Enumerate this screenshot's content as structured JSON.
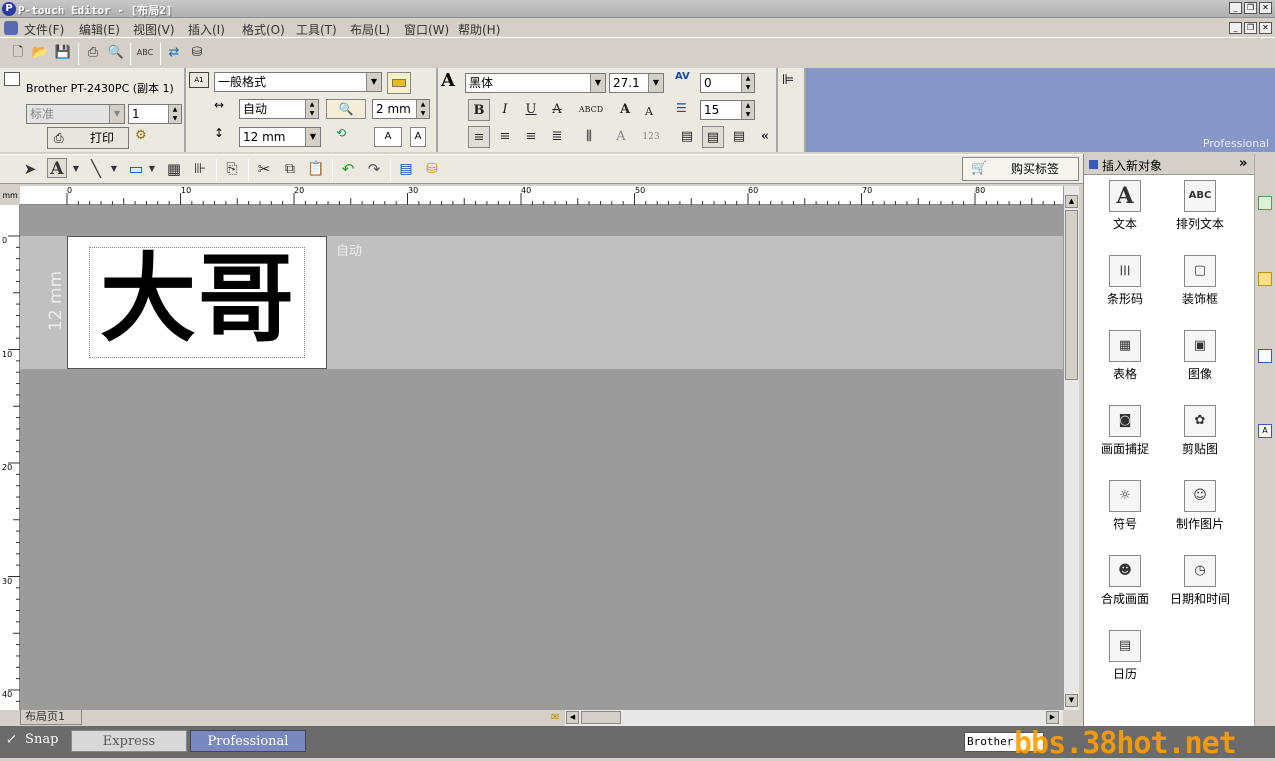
{
  "window": {
    "title": "P-touch Editor - [布局2]"
  },
  "menu": [
    "文件(F)",
    "编辑(E)",
    "视图(V)",
    "插入(I)",
    "格式(O)",
    "工具(T)",
    "布局(L)",
    "窗口(W)",
    "帮助(H)"
  ],
  "printer": {
    "name": "Brother PT-2430PC (副本 1)",
    "quality": "标准",
    "copies": "1",
    "print_label": "打印"
  },
  "label_format": {
    "style": "一般格式",
    "length": "自动",
    "margin": "2 mm",
    "tape_width": "12 mm"
  },
  "font": {
    "family": "黑体",
    "size": "27.1",
    "char_spacing": "0",
    "line_spacing": "15"
  },
  "ribbon_brand": "Professional",
  "toolbar": {
    "buy_labels": "购买标签"
  },
  "canvas": {
    "label_text": "大哥",
    "length_hint": "自动",
    "tape_width_text": "12 mm",
    "sheet_tab": "布局页1"
  },
  "ruler": {
    "unit": "mm",
    "h_ticks": [
      "0",
      "10",
      "20",
      "30",
      "40",
      "50",
      "60",
      "70",
      "80"
    ],
    "v_ticks": [
      "0",
      "10",
      "20",
      "30",
      "40"
    ]
  },
  "sidebar": {
    "title": "插入新对象",
    "items": [
      {
        "label": "文本",
        "icon": "text-icon",
        "glyph": "A"
      },
      {
        "label": "排列文本",
        "icon": "arranged-text-icon",
        "glyph": "ABC"
      },
      {
        "label": "条形码",
        "icon": "barcode-icon",
        "glyph": "|||"
      },
      {
        "label": "装饰框",
        "icon": "frame-icon",
        "glyph": "▢"
      },
      {
        "label": "表格",
        "icon": "table-icon",
        "glyph": "▦"
      },
      {
        "label": "图像",
        "icon": "image-icon",
        "glyph": "▣"
      },
      {
        "label": "画面捕捉",
        "icon": "screen-capture-icon",
        "glyph": "◙"
      },
      {
        "label": "剪贴图",
        "icon": "clip-art-icon",
        "glyph": "✿"
      },
      {
        "label": "符号",
        "icon": "symbol-icon",
        "glyph": "☼"
      },
      {
        "label": "制作图片",
        "icon": "make-picture-icon",
        "glyph": "☺"
      },
      {
        "label": "合成画面",
        "icon": "composite-screen-icon",
        "glyph": "☻"
      },
      {
        "label": "日期和时间",
        "icon": "clock-icon",
        "glyph": "◷"
      },
      {
        "label": "日历",
        "icon": "calendar-icon",
        "glyph": "▤"
      }
    ]
  },
  "status": {
    "snap": "Snap",
    "express": "Express",
    "professional": "Professional",
    "printer_short": "Brother"
  },
  "watermark": "bbs.38hot.net",
  "colors": {
    "accent": "#8796c8",
    "canvas": "#9b9b9b",
    "watermark": "#ffa000"
  }
}
